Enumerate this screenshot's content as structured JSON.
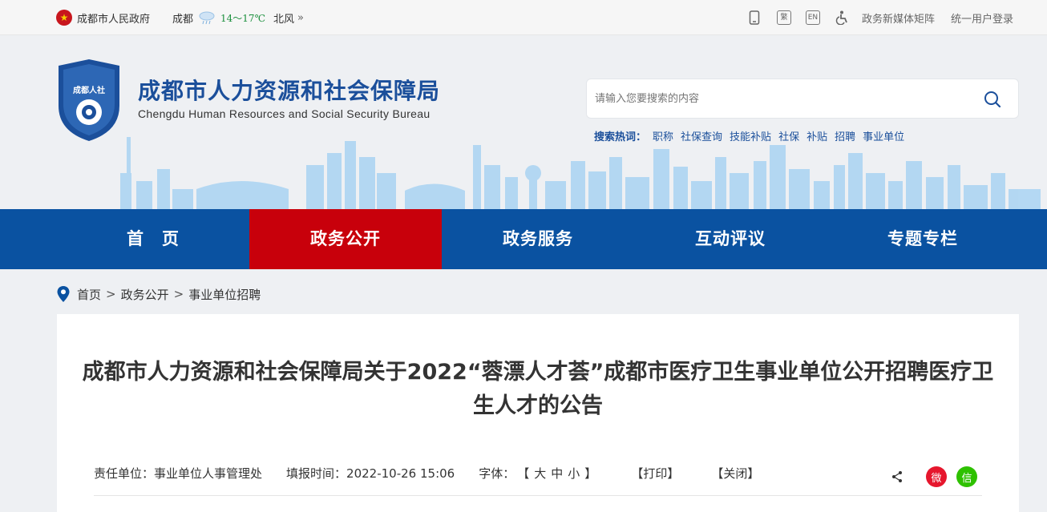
{
  "topbar": {
    "gov_link": "成都市人民政府",
    "city": "成都",
    "temperature": "14～17℃",
    "wind": "北风",
    "more": "»",
    "icons": [
      "mobile-icon",
      "traditional-chinese-icon",
      "english-icon",
      "accessibility-icon"
    ],
    "traditional_label": "繁",
    "english_label": "EN",
    "media_link": "政务新媒体矩阵",
    "login_link": "统一用户登录"
  },
  "header": {
    "logo_text": "成都人社",
    "site_name_cn": "成都市人力资源和社会保障局",
    "site_name_en": "Chengdu Human Resources and Social Security Bureau",
    "search_placeholder": "请输入您要搜索的内容",
    "hot_label": "搜索热词：",
    "hot_words": [
      "职称",
      "社保查询",
      "技能补贴",
      "社保",
      "补贴",
      "招聘",
      "事业单位"
    ]
  },
  "nav": {
    "items": [
      "首　页",
      "政务公开",
      "政务服务",
      "互动评议",
      "专题专栏"
    ],
    "active_index": 1
  },
  "breadcrumb": {
    "items": [
      "首页",
      "政务公开",
      "事业单位招聘"
    ],
    "separator": ">"
  },
  "article": {
    "title": "成都市人力资源和社会保障局关于2022“蓉漂人才荟”成都市医疗卫生事业单位公开招聘医疗卫生人才的公告",
    "dept_label": "责任单位：",
    "dept_value": "事业单位人事管理处",
    "time_label": "填报时间：",
    "time_value": "2022-10-26 15:06",
    "font_label": "字体：",
    "font_open": "【",
    "font_large": "大",
    "font_medium": "中",
    "font_small": "小",
    "font_close": "】",
    "print": "【打印】",
    "close": "【关闭】",
    "weibo_label": "微",
    "wechat_label": "信"
  },
  "colors": {
    "brand_blue": "#0a52a1",
    "active_red": "#c8000b",
    "title_blue": "#1b4f9b"
  }
}
